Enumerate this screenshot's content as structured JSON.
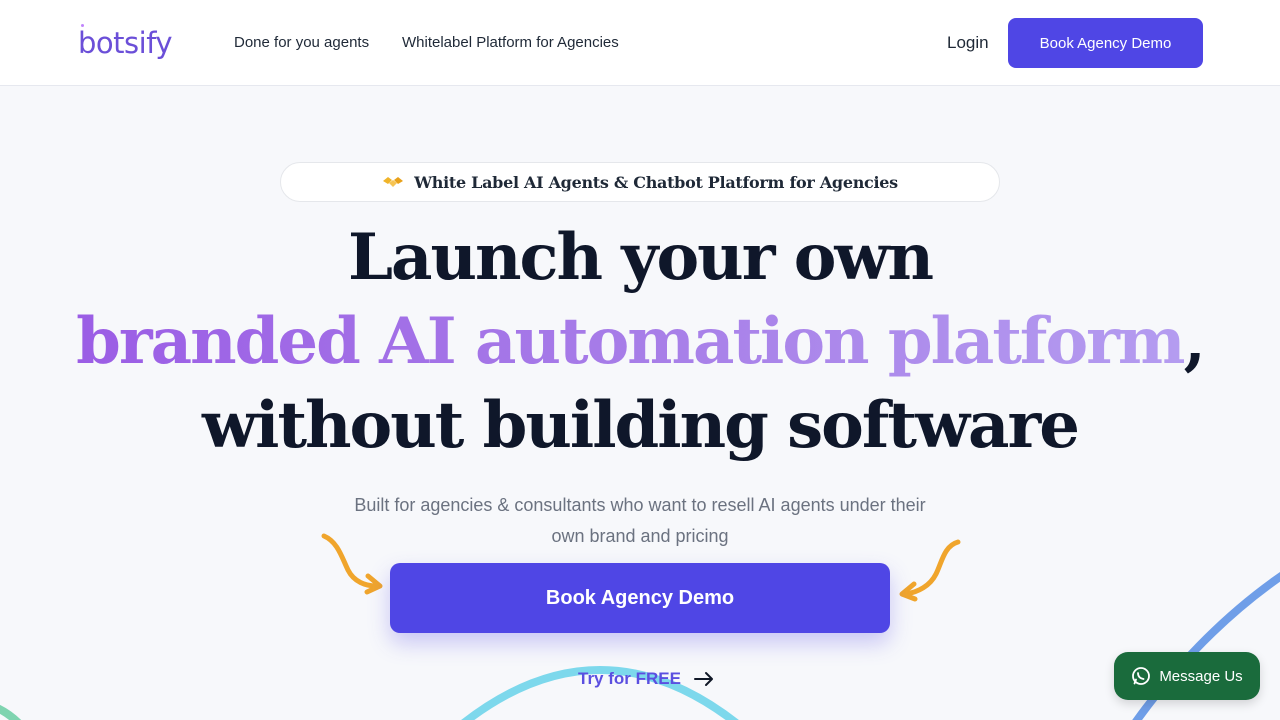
{
  "header": {
    "logo": "botsify",
    "nav": [
      "Done for you agents",
      "Whitelabel Platform for Agencies"
    ],
    "login": "Login",
    "cta": "Book Agency Demo"
  },
  "hero": {
    "badge": "White Label AI Agents & Chatbot Platform for Agencies",
    "headline_line1": "Launch your own",
    "headline_line2_highlight": "branded AI automation platform",
    "headline_line2_suffix": ",",
    "headline_line3": "without building software",
    "subtitle": "Built for agencies & consultants who want to resell AI agents under their own brand and pricing",
    "cta": "Book Agency Demo",
    "secondary_cta": "Try for FREE"
  },
  "widget": {
    "label": "Message Us"
  },
  "colors": {
    "primary": "#4f46e5",
    "highlight_start": "#9b5de5",
    "highlight_end": "#b49cf0",
    "arrow": "#f0a52c",
    "whatsapp": "#1a6b3c"
  },
  "icons": [
    "handshake-icon",
    "curved-arrow-icon",
    "arrow-right-icon",
    "whatsapp-icon"
  ]
}
